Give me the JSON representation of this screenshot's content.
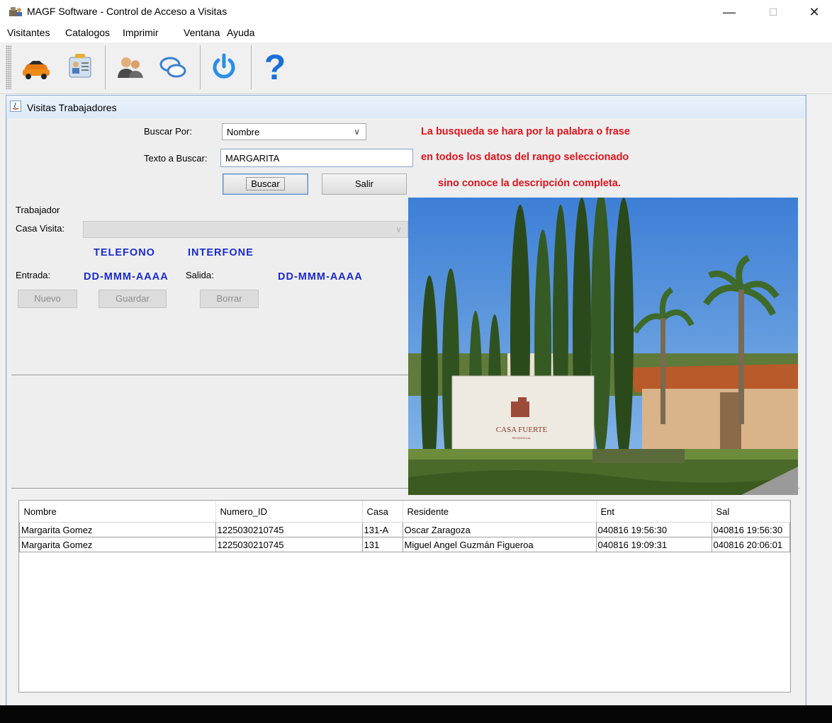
{
  "window": {
    "title": "MAGF Software - Control de Acceso a Visitas",
    "minimize": "—",
    "maximize": "☐",
    "close": "✕"
  },
  "menu": [
    "Visitantes",
    "Catalogos",
    "Imprimir",
    "Ventana",
    "Ayuda"
  ],
  "toolbar": {
    "buttons": [
      "car-icon",
      "id-card-icon",
      "users-icon",
      "chat-icon",
      "power-icon",
      "help-icon"
    ],
    "help_glyph": "?"
  },
  "frame": {
    "title": "Visitas Trabajadores"
  },
  "search": {
    "buscar_por_label": "Buscar Por:",
    "buscar_por_value": "Nombre",
    "texto_label": "Texto a Buscar:",
    "texto_value": "MARGARITA",
    "buscar_button": "Buscar",
    "salir_button": "Salir"
  },
  "hint": {
    "line1": "La busqueda se hara por la palabra o frase",
    "line2": "en todos los datos del rango seleccionado",
    "line3": "sino conoce la descripción completa."
  },
  "form": {
    "trabajador_label": "Trabajador",
    "casa_visita_label": "Casa Visita:",
    "telefono": "TELEFONO",
    "interfone": "INTERFONE",
    "entrada_label": "Entrada:",
    "entrada_value": "DD-MMM-AAAA",
    "salida_label": "Salida:",
    "salida_value": "DD-MMM-AAAA",
    "nuevo_button": "Nuevo",
    "guardar_button": "Guardar",
    "borrar_button": "Borrar"
  },
  "photo": {
    "sign_text": "CASA FUERTE",
    "sign_subtext": "RESIDENCIAL"
  },
  "table": {
    "columns": [
      "Nombre",
      "Numero_ID",
      "Casa",
      "Residente",
      "Ent",
      "Sal"
    ],
    "rows": [
      [
        "Margarita Gomez",
        "1225030210745",
        "131-A",
        "Oscar Zaragoza",
        "040816 19:56:30",
        "040816 19:56:30"
      ],
      [
        "Margarita Gomez",
        "1225030210745",
        "131",
        "Miguel Angel Guzmán Figueroa",
        "040816 19:09:31",
        "040816 20:06:01"
      ]
    ]
  },
  "colors": {
    "hint_red": "#e0141c",
    "label_blue": "#1a2bd0",
    "frame_border": "#8fb1d6"
  }
}
